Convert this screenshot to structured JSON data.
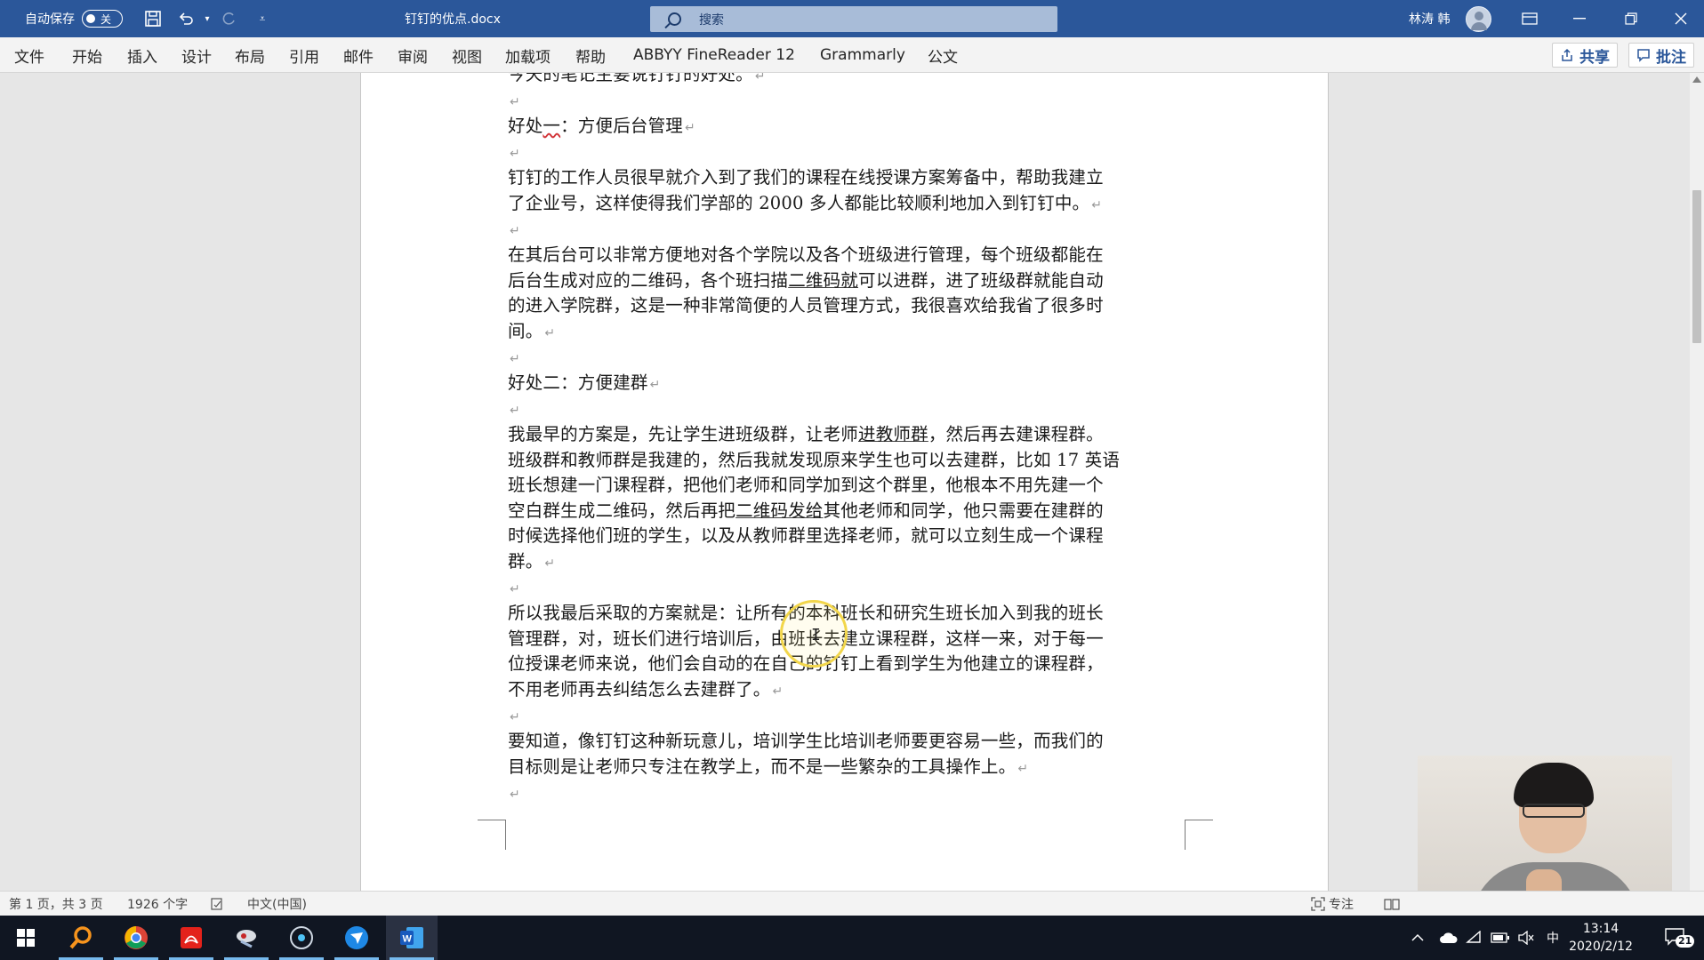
{
  "titlebar": {
    "autosave_label": "自动保存",
    "autosave_state": "关",
    "doc_title": "钉钉的优点.docx",
    "search_placeholder": "搜索",
    "user_name": "林涛 韩"
  },
  "ribbon": {
    "tabs": [
      "文件",
      "开始",
      "插入",
      "设计",
      "布局",
      "引用",
      "邮件",
      "审阅",
      "视图",
      "加载项",
      "帮助",
      "ABBYY FineReader 12",
      "Grammarly",
      "公文"
    ],
    "share_label": "共享",
    "comments_label": "批注"
  },
  "document": {
    "paragraphs": [
      {
        "text": "今天的笔记主要说钉钉的好处。"
      },
      {
        "text": ""
      },
      {
        "text": "好处一：方便后台管理"
      },
      {
        "text": ""
      },
      {
        "text": "钉钉的工作人员很早就介入到了我们的课程在线授课方案筹备中，帮助我建立了企业号，这样使得我们学部的 2000 多人都能比较顺利地加入到钉钉中。"
      },
      {
        "text": ""
      },
      {
        "text": "在其后台可以非常方便地对各个学院以及各个班级进行管理，每个班级都能在后台生成对应的二维码，各个班扫描二维码就可以进群，进了班级群就能自动的进入学院群，这是一种非常简便的人员管理方式，我很喜欢给我省了很多时间。"
      },
      {
        "text": ""
      },
      {
        "text": "好处二：方便建群"
      },
      {
        "text": ""
      },
      {
        "text": "我最早的方案是，先让学生进班级群，让老师进教师群，然后再去建课程群。班级群和教师群是我建的，然后我就发现原来学生也可以去建群，比如 17 英语班长想建一门课程群，把他们老师和同学加到这个群里，他根本不用先建一个空白群生成二维码，然后再把二维码发给其他老师和同学，他只需要在建群的时候选择他们班的学生，以及从教师群里选择老师，就可以立刻生成一个课程群。"
      },
      {
        "text": ""
      },
      {
        "text": "所以我最后采取的方案就是：让所有的本科班长和研究生班长加入到我的班长管理群，对，班长们进行培训后，由班长去建立课程群，这样一来，对于每一位授课老师来说，他们会自动的在自己的钉钉上看到学生为他建立的课程群，不用老师再去纠结怎么去建群了。"
      },
      {
        "text": ""
      },
      {
        "text": "要知道，像钉钉这种新玩意儿，培训学生比培训老师要更容易一些，而我们的目标则是让老师只专注在教学上，而不是一些繁杂的工具操作上。"
      },
      {
        "text": ""
      }
    ],
    "line_texts": [
      "今天的笔记主要说钉钉的好处。",
      "好处",
      "一",
      "：方便后台管理",
      "钉钉的工作人员很早就介入到了我们的课程在线授课方案筹备中，帮助我建立",
      "了企业号，这样使得我们学部的 2000 多人都能比较顺利地加入到钉钉中。",
      "在其后台可以非常方便地对各个学院以及各个班级进行管理，每个班级都能在",
      "后台生成对应的二维码，各个班扫描",
      "二维码就",
      "可以进群，进了班级群就能自动",
      "的进入学院群，这是一种非常简便的人员管理方式，我很喜欢给我省了很多时",
      "间。",
      "好处二：方便建群",
      "我最早的方案是，先让学生进班级群，让老师",
      "进教师群",
      "，然后再去建课程群。",
      "班级群和教师群是我建的，然后我就发现原来学生也可以去建群，比如 17 英语",
      "班长想建一门课程群，把他们老师和同学加到这个群里，他根本不用先建一个",
      "空白群生成二维码，然后再把",
      "二维码发给",
      "其他老师和同学，他只需要在建群的",
      "时候选择他们班的学生，以及从教师群里选择老师，就可以立刻生成一个课程",
      "群。",
      "所以我最后采取的方案就是：让所有的本科班长和研究生班长加入到我的班长",
      "管理群，对，班长们进行培训后，由班长去建立课程群，这样一来，对于每一",
      "位授课老师来说，他们会自动的在自己的钉钉上看到学生为他建立的课程群，",
      "不用老师再去纠结怎么去建群了。",
      "要知道，像钉钉这种新玩意儿，培训学生比培训老师要更容易一些，而我们的",
      "目标则是让老师只专注在教学上，而不是一些繁杂的工具操作上。"
    ],
    "paragraph_mark": "↵"
  },
  "statusbar": {
    "page_info": "第 1 页，共 3 页",
    "word_count": "1926 个字",
    "language": "中文(中国)",
    "focus_label": "专注"
  },
  "taskbar": {
    "time": "13:14",
    "date": "2020/2/12",
    "ime": "中",
    "notification_count": "21"
  },
  "colors": {
    "word_blue": "#2b579a",
    "taskbar_bg": "#101622"
  },
  "icons": [
    "save-icon",
    "undo-icon",
    "redo-icon",
    "customize-icon",
    "search-icon",
    "ribbon-display-icon",
    "minimize-icon",
    "restore-icon",
    "close-icon",
    "share-icon",
    "comment-icon",
    "proofing-icon",
    "focus-icon",
    "read-mode-icon",
    "windows-start-icon",
    "search-app-icon",
    "chrome-icon",
    "acrobat-icon",
    "app-icon",
    "circle-app-icon",
    "feishu-icon",
    "word-icon",
    "tray-chevron-icon",
    "onedrive-icon",
    "wifi-icon",
    "battery-icon",
    "volume-icon",
    "notification-icon"
  ]
}
